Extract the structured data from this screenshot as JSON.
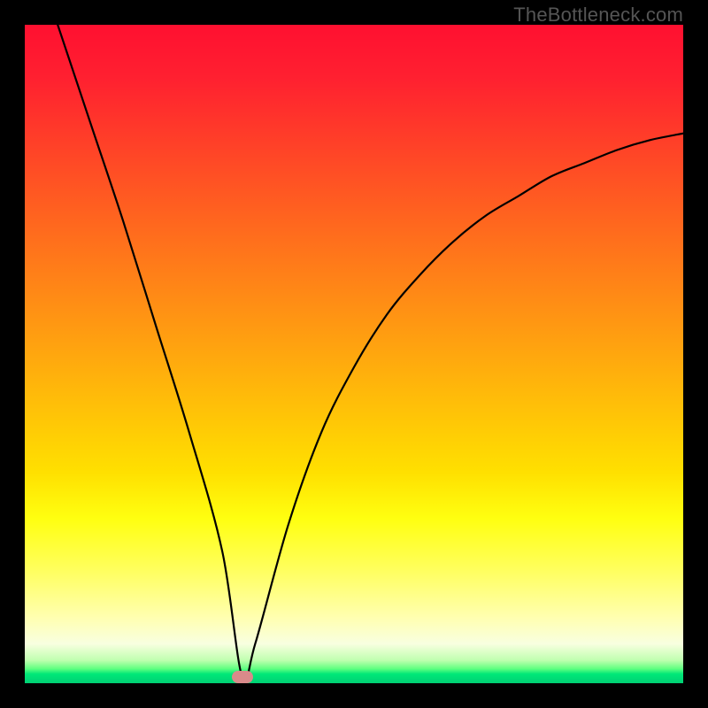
{
  "watermark": "TheBottleneck.com",
  "chart_data": {
    "type": "line",
    "title": "",
    "xlabel": "",
    "ylabel": "",
    "xlim": [
      0,
      100
    ],
    "ylim": [
      0,
      100
    ],
    "series": [
      {
        "name": "bottleneck-curve",
        "x": [
          5,
          10,
          15,
          20,
          25,
          30,
          33,
          35,
          40,
          45,
          50,
          55,
          60,
          65,
          70,
          75,
          80,
          85,
          90,
          95,
          100
        ],
        "values": [
          100,
          85,
          70,
          54,
          38,
          20,
          1,
          6,
          24,
          38,
          48,
          56,
          62,
          67,
          71,
          74,
          77,
          79,
          81,
          82.5,
          83.5
        ]
      }
    ],
    "marker": {
      "x_pct": 33,
      "y_pct": 1
    },
    "gradient_stops": [
      {
        "pct": 0,
        "color": "#ff1030"
      },
      {
        "pct": 50,
        "color": "#ffc000"
      },
      {
        "pct": 80,
        "color": "#ffff30"
      },
      {
        "pct": 100,
        "color": "#00d074"
      }
    ]
  }
}
